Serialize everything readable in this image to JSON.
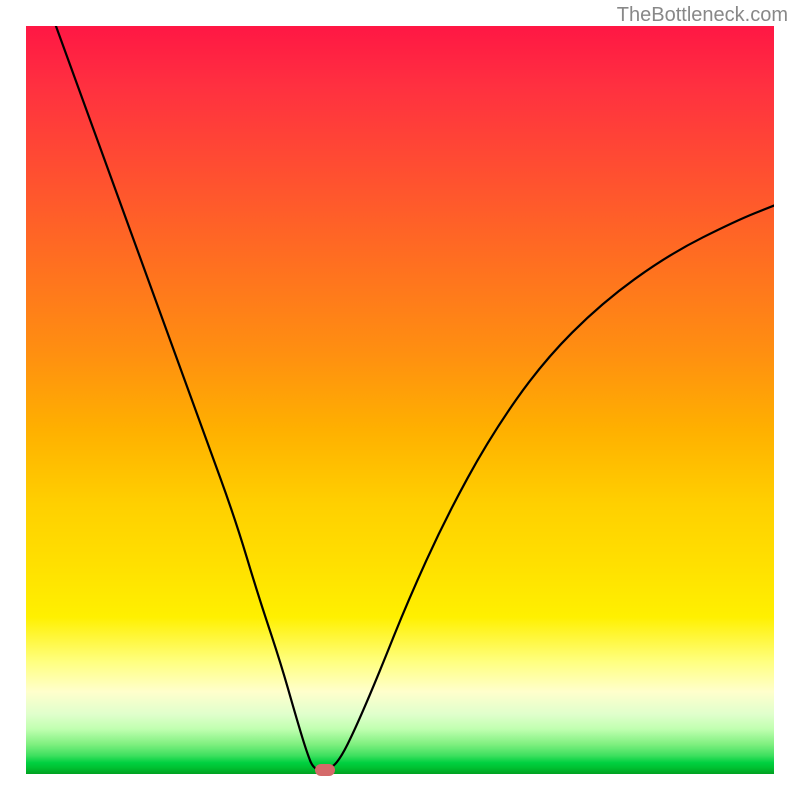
{
  "watermark": "TheBottleneck.com",
  "chart_data": {
    "type": "line",
    "title": "",
    "xlabel": "",
    "ylabel": "",
    "xlim": [
      0,
      100
    ],
    "ylim": [
      0,
      100
    ],
    "curve_points": [
      {
        "x": 4.0,
        "y": 100.0
      },
      {
        "x": 8.0,
        "y": 89.0
      },
      {
        "x": 12.0,
        "y": 78.0
      },
      {
        "x": 16.0,
        "y": 67.0
      },
      {
        "x": 20.0,
        "y": 56.0
      },
      {
        "x": 24.0,
        "y": 45.0
      },
      {
        "x": 28.0,
        "y": 34.0
      },
      {
        "x": 31.0,
        "y": 24.0
      },
      {
        "x": 34.0,
        "y": 15.0
      },
      {
        "x": 36.0,
        "y": 8.0
      },
      {
        "x": 37.5,
        "y": 3.0
      },
      {
        "x": 38.5,
        "y": 0.5
      },
      {
        "x": 40.5,
        "y": 0.5
      },
      {
        "x": 42.0,
        "y": 2.0
      },
      {
        "x": 44.0,
        "y": 6.0
      },
      {
        "x": 47.0,
        "y": 13.0
      },
      {
        "x": 51.0,
        "y": 23.0
      },
      {
        "x": 56.0,
        "y": 34.0
      },
      {
        "x": 62.0,
        "y": 45.0
      },
      {
        "x": 69.0,
        "y": 55.0
      },
      {
        "x": 77.0,
        "y": 63.0
      },
      {
        "x": 86.0,
        "y": 69.5
      },
      {
        "x": 95.0,
        "y": 74.0
      },
      {
        "x": 100.0,
        "y": 76.0
      }
    ],
    "marker": {
      "x": 40.0,
      "y": 0.5
    },
    "gradient_stops": [
      {
        "pos": 0,
        "color": "#ff1744"
      },
      {
        "pos": 50,
        "color": "#ffb000"
      },
      {
        "pos": 85,
        "color": "#ffff80"
      },
      {
        "pos": 100,
        "color": "#00a020"
      }
    ]
  }
}
